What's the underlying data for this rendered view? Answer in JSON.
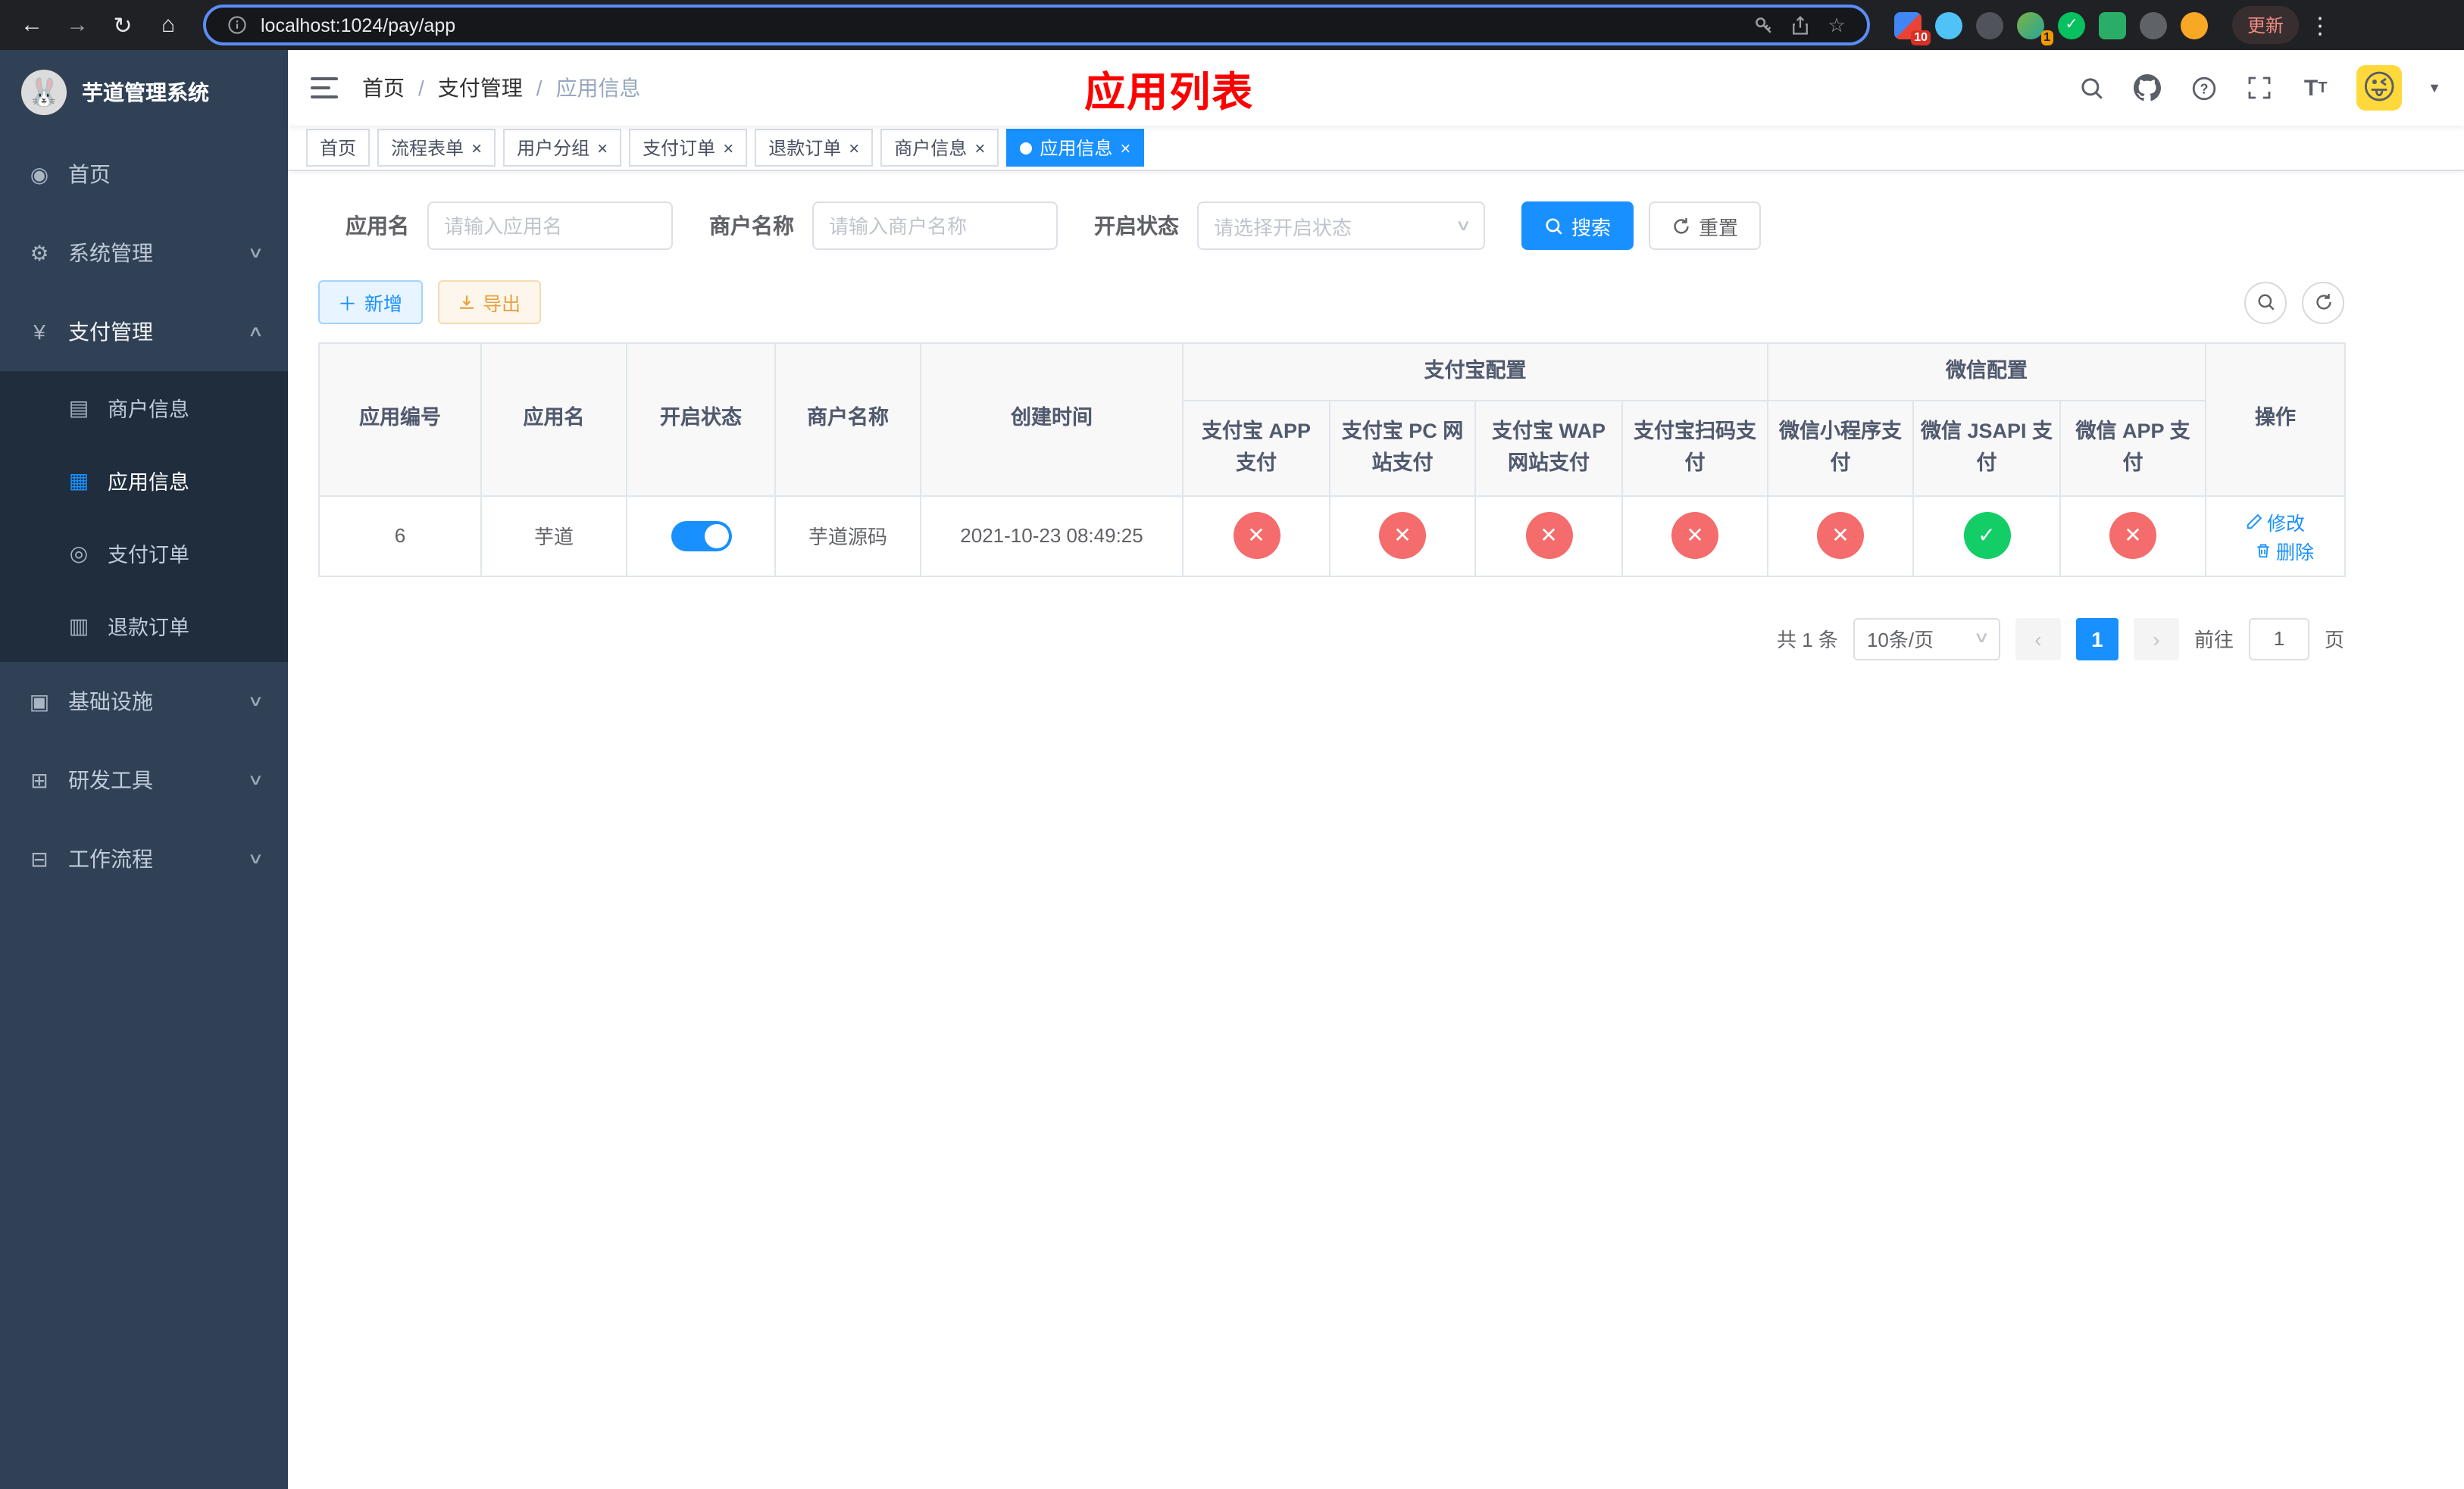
{
  "browser": {
    "url": "localhost:1024/pay/app",
    "update_label": "更新",
    "ext_badges": {
      "first": "10",
      "avatar": "1"
    }
  },
  "icons": {
    "back": "←",
    "forward": "→",
    "refresh": "↻",
    "home": "⌂",
    "star": "☆",
    "menu_dots": "⋮",
    "dashboard": "◉",
    "gear": "⚙",
    "yen": "¥",
    "card": "▤",
    "grid": "▦",
    "order": "◎",
    "refund": "▥",
    "infra": "▣",
    "tools": "⊞",
    "flow": "⊟",
    "chevron_down": "∨",
    "chevron_up": "∧",
    "caret_down": "▼",
    "close": "×",
    "plus": "＋",
    "yes": "✓",
    "no": "✕",
    "logo_emoji": "🐰",
    "avatar_emoji": "😜"
  },
  "sidebar": {
    "logo_title": "芋道管理系统",
    "items": [
      {
        "label": "首页"
      },
      {
        "label": "系统管理"
      },
      {
        "label": "支付管理"
      },
      {
        "label": "商户信息"
      },
      {
        "label": "应用信息"
      },
      {
        "label": "支付订单"
      },
      {
        "label": "退款订单"
      },
      {
        "label": "基础设施"
      },
      {
        "label": "研发工具"
      },
      {
        "label": "工作流程"
      }
    ]
  },
  "header": {
    "breadcrumb": {
      "home": "首页",
      "parent": "支付管理",
      "current": "应用信息"
    },
    "page_title": "应用列表"
  },
  "tabs": [
    {
      "label": "首页"
    },
    {
      "label": "流程表单"
    },
    {
      "label": "用户分组"
    },
    {
      "label": "支付订单"
    },
    {
      "label": "退款订单"
    },
    {
      "label": "商户信息"
    },
    {
      "label": "应用信息"
    }
  ],
  "filters": {
    "app_name_label": "应用名",
    "app_name_placeholder": "请输入应用名",
    "merchant_label": "商户名称",
    "merchant_placeholder": "请输入商户名称",
    "status_label": "开启状态",
    "status_placeholder": "请选择开启状态",
    "search_label": "搜索",
    "reset_label": "重置"
  },
  "toolbar": {
    "add_label": "新增",
    "export_label": "导出"
  },
  "table": {
    "groups": {
      "alipay": "支付宝配置",
      "wechat": "微信配置"
    },
    "columns": [
      "应用编号",
      "应用名",
      "开启状态",
      "商户名称",
      "创建时间",
      "支付宝 APP 支付",
      "支付宝 PC 网站支付",
      "支付宝 WAP 网站支付",
      "支付宝扫码支付",
      "微信小程序支付",
      "微信 JSAPI 支付",
      "微信 APP 支付",
      "操作"
    ],
    "rows": [
      {
        "id": "6",
        "name": "芋道",
        "status_on": true,
        "merchant": "芋道源码",
        "created": "2021-10-23 08:49:25",
        "configs": [
          "no",
          "no",
          "no",
          "no",
          "no",
          "yes",
          "no"
        ],
        "edit_label": "修改",
        "delete_label": "删除"
      }
    ]
  },
  "pagination": {
    "total_text": "共 1 条",
    "page_size": "10条/页",
    "current_page": "1",
    "goto_label": "前往",
    "goto_value": "1",
    "page_suffix": "页"
  },
  "colors": {
    "primary": "#1890ff",
    "danger": "#f56c6c",
    "success": "#13ce66",
    "title_red": "#fe0000"
  }
}
